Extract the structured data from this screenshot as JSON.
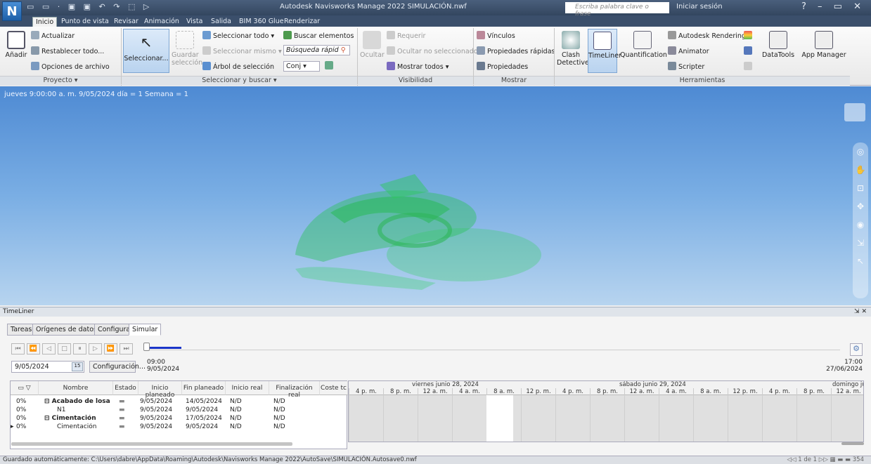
{
  "app": {
    "logo": "N",
    "title": "Autodesk Navisworks Manage 2022   SIMULACIÓN.nwf",
    "qat_icons": "▭ ▭ · ▣ ▣ ↶ ↷  ⬚ ▷",
    "search_placeholder": "Escriba palabra clave o frase",
    "signin": "Iniciar sesión",
    "window_buttons": "? – ▭ ✕"
  },
  "tabs": [
    "Inicio",
    "Punto de vista",
    "Revisar",
    "Animación",
    "Vista",
    "Salida",
    "BIM 360 Glue",
    "Renderizar"
  ],
  "ribbon": {
    "proyecto": {
      "add": "Añadir",
      "refresh": "Actualizar",
      "reset": "Restablecer todo...",
      "file_options": "Opciones de archivo",
      "label": "Proyecto ▾"
    },
    "select": {
      "select": "Seleccionar...",
      "save_sel": "Guardar selección",
      "select_all": "Seleccionar todo",
      "select_same": "Seleccionar mismo",
      "tree": "Árbol de selección",
      "find": "Buscar elementos",
      "quick_find": "Búsqueda rápid",
      "sets": "Conj ▾",
      "label": "Seleccionar y buscar ▾"
    },
    "visibility": {
      "hide": "Ocultar",
      "require": "Requerir",
      "hide_unselected": "Ocultar no seleccionados",
      "show_all": "Mostrar todos",
      "label": "Visibilidad"
    },
    "show": {
      "links": "Vínculos",
      "quick_props": "Propiedades rápidas",
      "props": "Propiedades",
      "label": "Mostrar"
    },
    "tools": {
      "clash": "Clash Detective",
      "timeliner": "TimeLiner",
      "quantification": "Quantification",
      "rendering": "Autodesk Rendering",
      "animator": "Animator",
      "scripter": "Scripter",
      "datatools": "DataTools",
      "appmanager": "App Manager",
      "label": "Herramientas"
    }
  },
  "viewport": {
    "overlay": "jueves 9:00:00 a. m. 9/05/2024 día = 1 Semana = 1"
  },
  "timeliner": {
    "title": "TimeLiner",
    "subtabs": [
      "Tareas",
      "Orígenes de datos",
      "Configurar",
      "Simular"
    ],
    "date_value": "9/05/2024",
    "config_btn": "Configuración...",
    "time_start": "09:00",
    "date_start": "9/05/2024",
    "time_end": "17:00",
    "date_end": "27/06/2024",
    "columns": [
      "Nombre",
      "Estado",
      "Inicio planeado",
      "Fin planeado",
      "Inicio real",
      "Finalización real",
      "Coste tc"
    ],
    "rows": [
      {
        "pct": "0%",
        "name": "⊟ Acabado de losa",
        "bold": true,
        "start": "9/05/2024",
        "end": "14/05/2024",
        "rs": "N/D",
        "re": "N/D"
      },
      {
        "pct": "0%",
        "name": "N1",
        "bold": false,
        "start": "9/05/2024",
        "end": "9/05/2024",
        "rs": "N/D",
        "re": "N/D"
      },
      {
        "pct": "0%",
        "name": "⊟ Cimentación",
        "bold": true,
        "start": "9/05/2024",
        "end": "17/05/2024",
        "rs": "N/D",
        "re": "N/D"
      },
      {
        "pct": "0%",
        "name": "Cimentación",
        "bold": false,
        "start": "9/05/2024",
        "end": "9/05/2024",
        "rs": "N/D",
        "re": "N/D"
      }
    ],
    "gantt_days": [
      "viernes junio 28, 2024",
      "sábado junio 29, 2024",
      "domingo jur"
    ],
    "gantt_times": [
      "4 p. m.",
      "8 p. m.",
      "12 a. m.",
      "4 a. m.",
      "8 a. m.",
      "12 p. m.",
      "4 p. m.",
      "8 p. m.",
      "12 a. m.",
      "4 a. m.",
      "8 a. m.",
      "12 p. m.",
      "4 p. m.",
      "8 p. m.",
      "12 a. m."
    ]
  },
  "status": {
    "text": "Guardado automáticamente: C:\\Users\\dabre\\AppData\\Roaming\\Autodesk\\Navisworks Manage 2022\\AutoSave\\SIMULACIÓN.Autosave0.nwf",
    "page": "1 de 1",
    "mem": "354"
  }
}
